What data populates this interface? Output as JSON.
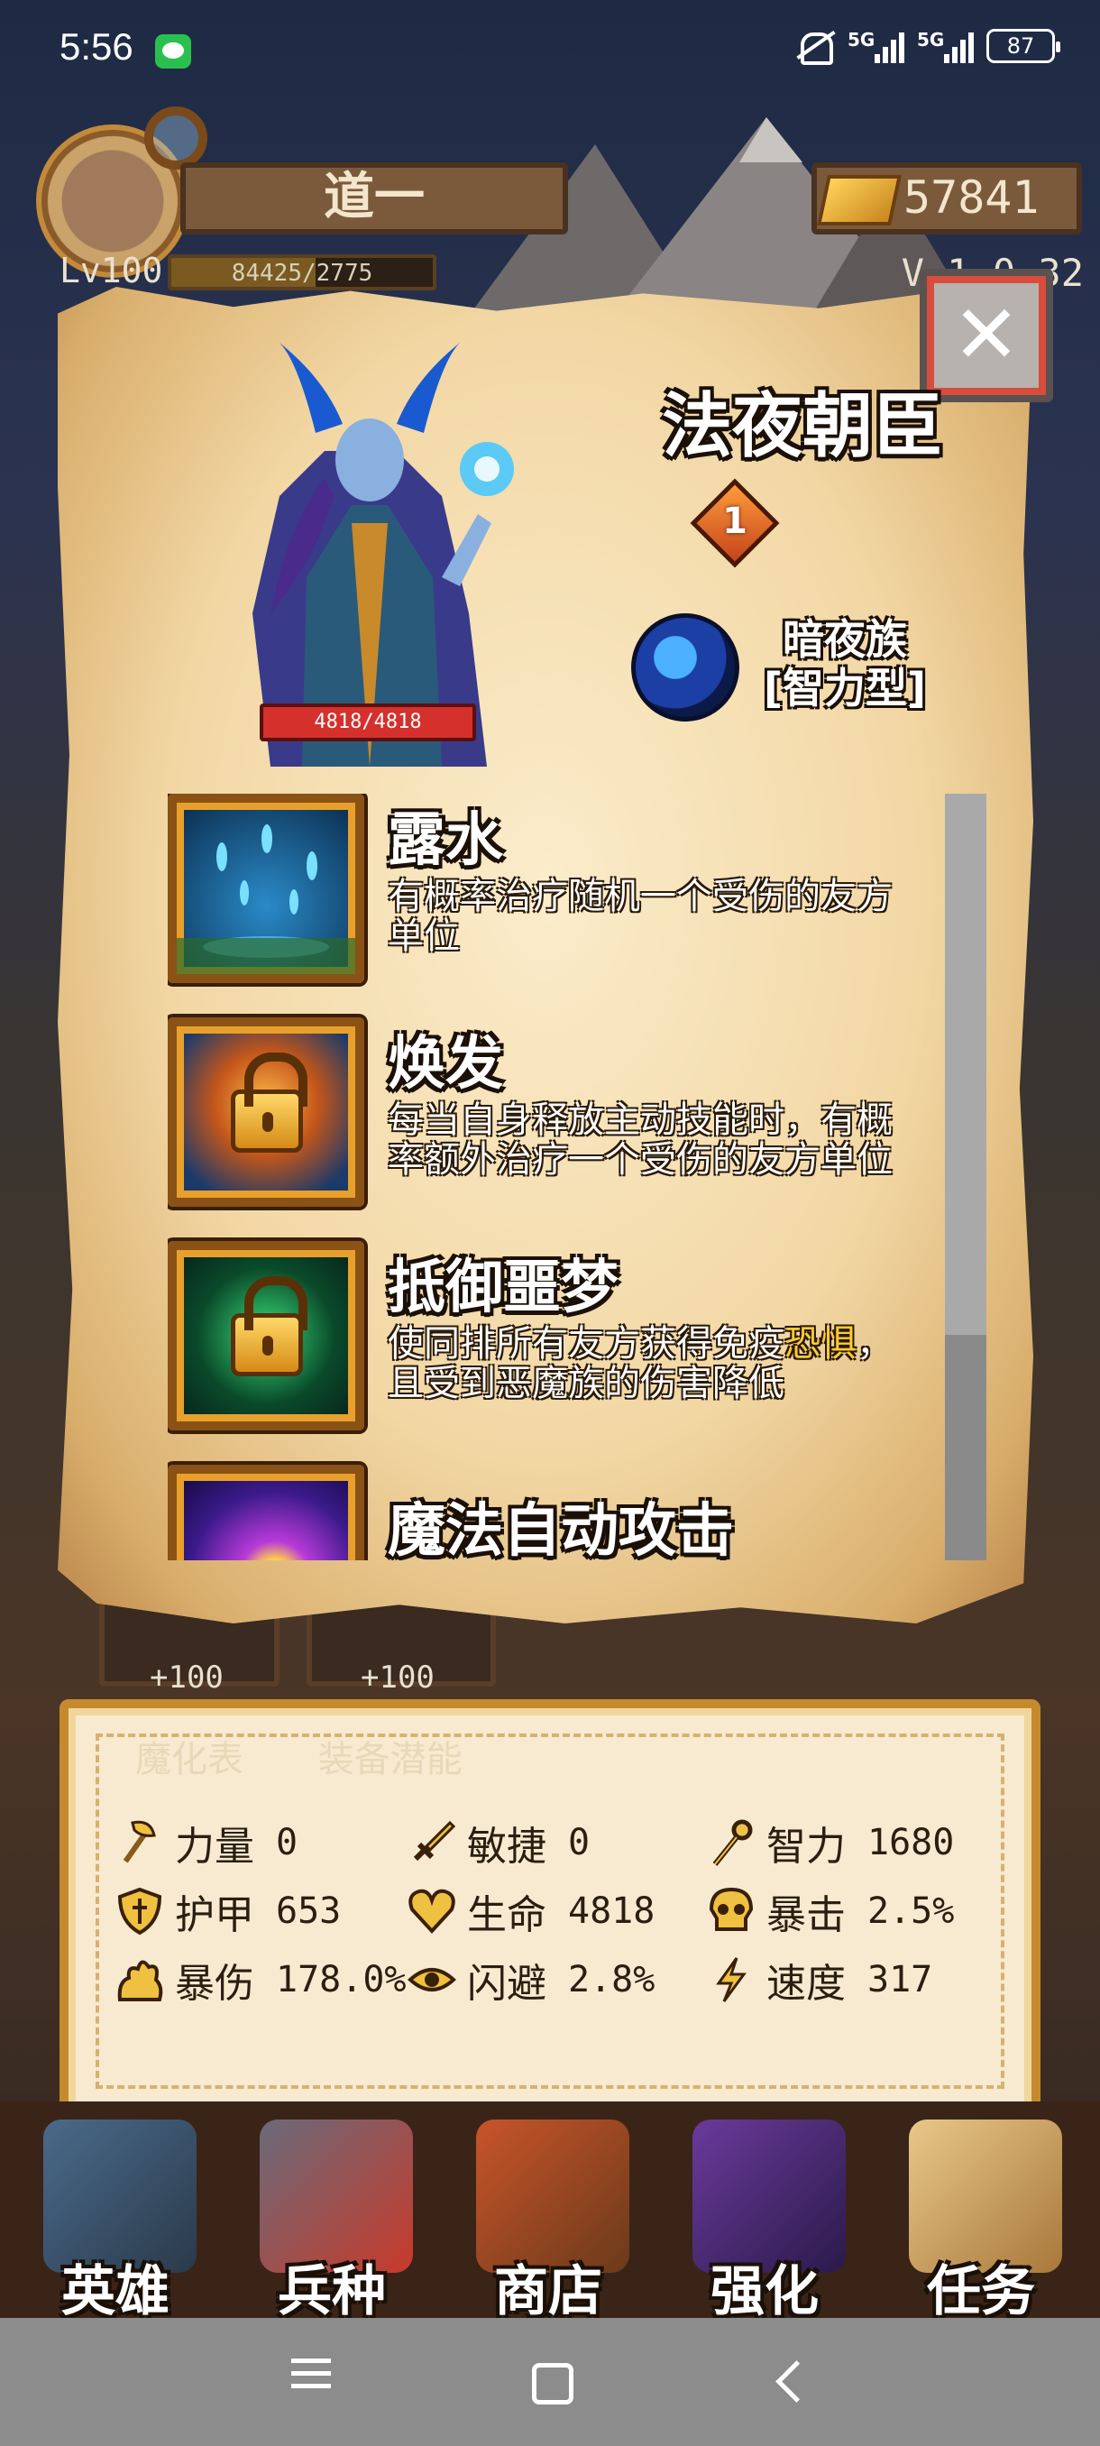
{
  "status_bar": {
    "time": "5:56",
    "network_1": "5G",
    "network_2": "5G",
    "battery": "87"
  },
  "hud": {
    "player_name": "道一",
    "gold": "57841",
    "level": "Lv100",
    "xp": "84425/2775",
    "xp_progress": 0.55,
    "version": "V 1.0.32"
  },
  "background": {
    "slot_1_plus": "+100",
    "slot_2_plus": "+100"
  },
  "hero": {
    "name": "法夜朝臣",
    "rank": "1",
    "hp": "4818/4818",
    "race": "暗夜族",
    "type": "[智力型]"
  },
  "skills": [
    {
      "name": "露水",
      "desc": "有概率治疗随机一个受伤的友方单位",
      "locked": false,
      "icon": "rain-drops-icon"
    },
    {
      "name": "焕发",
      "desc": "每当自身释放主动技能时，有概率额外治疗一个受伤的友方单位",
      "locked": true,
      "icon": "lock-icon"
    },
    {
      "name": "抵御噩梦",
      "desc_a": "使同排所有友方获得免疫",
      "desc_hl": "恐惧",
      "desc_b": "，且受到恶魔族的伤害降低",
      "locked": true,
      "icon": "lock-icon"
    },
    {
      "name": "魔法自动攻击",
      "locked": false,
      "icon": "magic-vortex-icon"
    }
  ],
  "stats_tabs": [
    "魔化表",
    "装备潜能"
  ],
  "stats": [
    {
      "label": "力量",
      "value": "0",
      "icon": "axe-icon"
    },
    {
      "label": "敏捷",
      "value": "0",
      "icon": "sword-icon"
    },
    {
      "label": "智力",
      "value": "1680",
      "icon": "staff-icon"
    },
    {
      "label": "护甲",
      "value": "653",
      "icon": "shield-icon"
    },
    {
      "label": "生命",
      "value": "4818",
      "icon": "heart-icon"
    },
    {
      "label": "暴击",
      "value": "2.5%",
      "icon": "skull-icon"
    },
    {
      "label": "暴伤",
      "value": "178.0%",
      "icon": "burst-icon"
    },
    {
      "label": "闪避",
      "value": "2.8%",
      "icon": "eye-icon"
    },
    {
      "label": "速度",
      "value": "317",
      "icon": "lightning-icon"
    }
  ],
  "bottom_nav": [
    "英雄",
    "兵种",
    "商店",
    "强化",
    "任务"
  ],
  "colors": {
    "parchment": "#f2d7a4",
    "highlight": "#ffcc33",
    "hp_red": "#d6302c",
    "frame_gold": "#e8a02c"
  }
}
